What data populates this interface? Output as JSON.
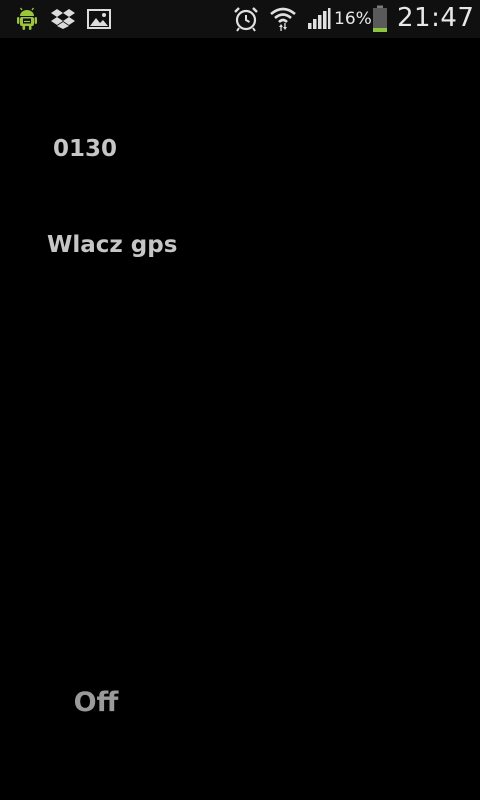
{
  "status_bar": {
    "notification_icons": [
      "android-debug-icon",
      "dropbox-icon",
      "image-icon"
    ],
    "system_icons": [
      "alarm-clock-icon",
      "wifi-icon",
      "signal-icon",
      "battery-icon"
    ],
    "battery_percent": "16%",
    "battery_level": 0.16,
    "battery_color": "#8cc63f",
    "time": "21:47"
  },
  "content": {
    "code_text": "0130",
    "gps_label": "Wlacz gps",
    "toggle_state": "Off"
  }
}
